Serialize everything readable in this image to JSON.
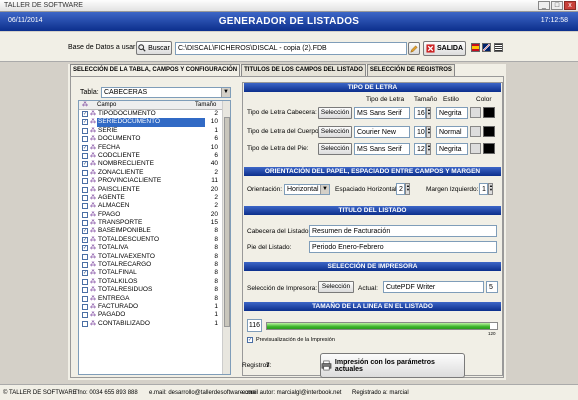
{
  "window": {
    "title": "TALLER DE SOFTWARE",
    "min": "_",
    "max": "□",
    "close": "x"
  },
  "header": {
    "date": "06/11/2014",
    "title": "GENERADOR  DE  LISTADOS",
    "time": "17:12:58"
  },
  "db": {
    "label": "Base de Datos a usar:",
    "browse_label": "Buscar",
    "path": "C:\\DISCAL\\FICHEROS\\DISCAL - copia (2).FDB",
    "exit_label": "SALIDA"
  },
  "tabs": [
    {
      "label": "SELECCIÓN DE LA TABLA, CAMPOS Y CONFIGURACIÓN"
    },
    {
      "label": "TITULOS DE LOS CAMPOS DEL LISTADO"
    },
    {
      "label": "SELECCIÓN DE REGISTROS"
    }
  ],
  "table_select": {
    "label": "Tabla:",
    "value": "CABECERAS",
    "arrow": "▼"
  },
  "field_list": {
    "col_field": "Campo",
    "col_size": "Tamaño",
    "rows": [
      {
        "name": "TIPODOCUMENTO",
        "size": "2",
        "checked": true,
        "selected": false
      },
      {
        "name": "SERIEDOCUMENTO",
        "size": "10",
        "checked": true,
        "selected": true
      },
      {
        "name": "SERIE",
        "size": "1",
        "checked": false,
        "selected": false
      },
      {
        "name": "DOCUMENTO",
        "size": "6",
        "checked": false,
        "selected": false
      },
      {
        "name": "FECHA",
        "size": "10",
        "checked": true,
        "selected": false
      },
      {
        "name": "CODCLIENTE",
        "size": "6",
        "checked": false,
        "selected": false
      },
      {
        "name": "NOMBRECLIENTE",
        "size": "40",
        "checked": true,
        "selected": false
      },
      {
        "name": "ZONACLIENTE",
        "size": "2",
        "checked": false,
        "selected": false
      },
      {
        "name": "PROVINCIACLIENTE",
        "size": "11",
        "checked": false,
        "selected": false
      },
      {
        "name": "PAISCLIENTE",
        "size": "20",
        "checked": false,
        "selected": false
      },
      {
        "name": "AGENTE",
        "size": "2",
        "checked": false,
        "selected": false
      },
      {
        "name": "ALMACEN",
        "size": "2",
        "checked": false,
        "selected": false
      },
      {
        "name": "FPAGO",
        "size": "20",
        "checked": false,
        "selected": false
      },
      {
        "name": "TRANSPORTE",
        "size": "15",
        "checked": false,
        "selected": false
      },
      {
        "name": "BASEIMPONIBLE",
        "size": "8",
        "checked": true,
        "selected": false
      },
      {
        "name": "TOTALDESCUENTO",
        "size": "8",
        "checked": true,
        "selected": false
      },
      {
        "name": "TOTALIVA",
        "size": "8",
        "checked": true,
        "selected": false
      },
      {
        "name": "TOTALIVAEXENTO",
        "size": "8",
        "checked": false,
        "selected": false
      },
      {
        "name": "TOTALRECARGO",
        "size": "8",
        "checked": false,
        "selected": false
      },
      {
        "name": "TOTALFINAL",
        "size": "8",
        "checked": true,
        "selected": false
      },
      {
        "name": "TOTALKILOS",
        "size": "8",
        "checked": false,
        "selected": false
      },
      {
        "name": "TOTALRESIDUOS",
        "size": "8",
        "checked": false,
        "selected": false
      },
      {
        "name": "ENTREGA",
        "size": "8",
        "checked": false,
        "selected": false
      },
      {
        "name": "FACTURADO",
        "size": "1",
        "checked": false,
        "selected": false
      },
      {
        "name": "PAGADO",
        "size": "1",
        "checked": false,
        "selected": false
      },
      {
        "name": "CONTABILIZADO",
        "size": "1",
        "checked": false,
        "selected": false
      }
    ]
  },
  "font_section": {
    "title": "TIPO DE LETRA",
    "col_font": "Tipo de Letra",
    "col_size": "Tamaño",
    "col_style": "Estilo",
    "col_color": "Color",
    "select_label": "Selección",
    "rows": [
      {
        "label": "Tipo de Letra Cabecera:",
        "font": "MS Sans Serif",
        "size": "16",
        "style": "Negrita"
      },
      {
        "label": "Tipo de Letra del Cuerpo:",
        "font": "Courier New",
        "size": "10",
        "style": "Normal"
      },
      {
        "label": "Tipo de Letra del Pie:",
        "font": "MS Sans Serif",
        "size": "12",
        "style": "Negrita"
      }
    ]
  },
  "orientation_section": {
    "title": "ORIENTACIÓN  DEL PAPEL, ESPACIADO ENTRE CAMPOS Y MARGEN",
    "orientation_label": "Orientación:",
    "orientation_value": "Horizontal",
    "spacing_label": "Espaciado Horizontal:",
    "spacing_value": "2",
    "margin_label": "Margen Izquierdo:",
    "margin_value": "1"
  },
  "title_section": {
    "title": "TITULO  DEL  LISTADO",
    "header_label": "Cabecera del Listado:",
    "header_value": "Resumen de Facturación",
    "footer_label": "Pie del Listado:",
    "footer_value": "Periodo Enero-Febrero"
  },
  "printer_section": {
    "title": "SELECCIÓN  DE  IMPRESORA",
    "label": "Selección de Impresora:",
    "button": "Selección",
    "current_label": "Actual:",
    "current_value": "CutePDF Writer",
    "count": "5"
  },
  "size_section": {
    "title": "TAMAÑO DE LA LINEA EN EL LISTADO",
    "value_box": "116",
    "progress_fraction": 0.97,
    "max_label": "120",
    "preview_label": "Previsualización de la Impresión"
  },
  "registros": {
    "label": "Registros:",
    "value": "7"
  },
  "print_button": "Impresión con los parámetros actuales",
  "footer": {
    "brand": "© TALLER DE SOFTWARE",
    "phone": "Tfno:  0034 655 893 888",
    "email": "e.mail:  desarrollo@tallerdesoftware.com",
    "author": "e.mail autor:  marcialgl@interbook.net",
    "registered": "Registrado a:  marcial"
  },
  "colors": {
    "banner": "#0c2f8c",
    "selection": "#316ac5",
    "progress": "#3bb52a",
    "swatch": "#000000"
  }
}
